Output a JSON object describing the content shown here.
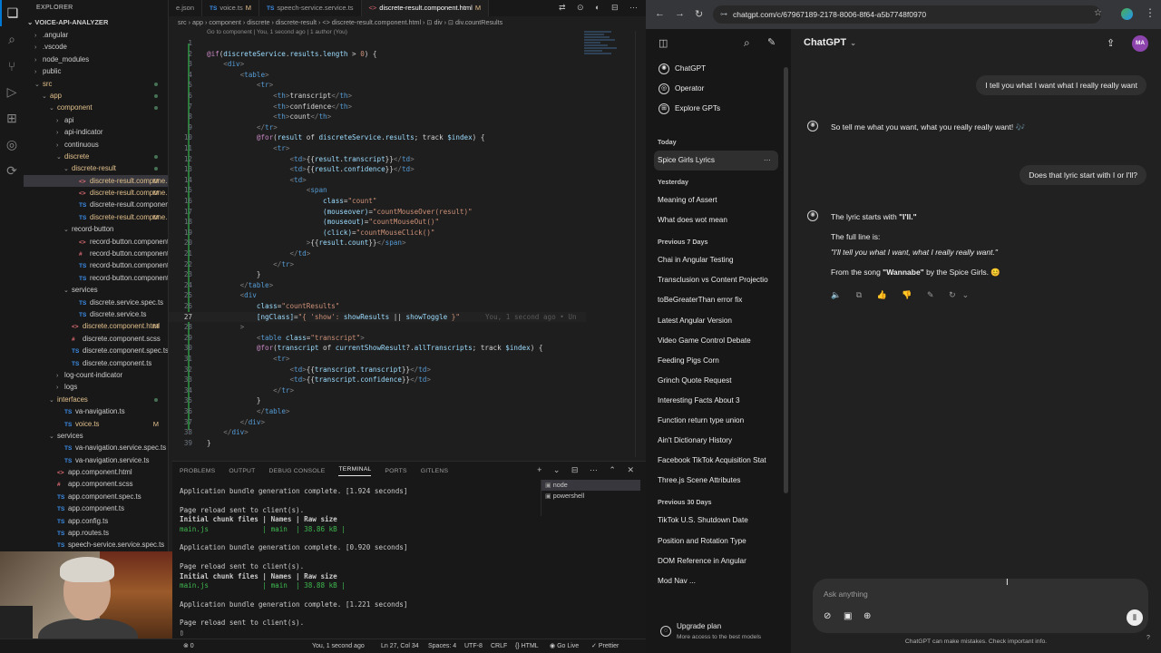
{
  "vscode": {
    "explorer_title": "EXPLORER",
    "project_name": "VOICE-API-ANALYZER",
    "tree": [
      {
        "label": ".angular",
        "indent": 1,
        "chev": "›",
        "icon": "",
        "icon_cls": ""
      },
      {
        "label": ".vscode",
        "indent": 1,
        "chev": "›",
        "icon": "",
        "icon_cls": ""
      },
      {
        "label": "node_modules",
        "indent": 1,
        "chev": "›",
        "icon": "",
        "icon_cls": ""
      },
      {
        "label": "public",
        "indent": 1,
        "chev": "›",
        "icon": "",
        "icon_cls": ""
      },
      {
        "label": "src",
        "indent": 1,
        "chev": "⌄",
        "icon": "",
        "icon_cls": "",
        "cls": "c-orange",
        "dot": true
      },
      {
        "label": "app",
        "indent": 2,
        "chev": "⌄",
        "icon": "",
        "icon_cls": "",
        "cls": "c-orange",
        "dot": true
      },
      {
        "label": "component",
        "indent": 3,
        "chev": "⌄",
        "icon": "",
        "icon_cls": "",
        "cls": "c-orange",
        "dot": true
      },
      {
        "label": "api",
        "indent": 4,
        "chev": "›",
        "icon": "",
        "icon_cls": ""
      },
      {
        "label": "api-indicator",
        "indent": 4,
        "chev": "›",
        "icon": "",
        "icon_cls": ""
      },
      {
        "label": "continuous",
        "indent": 4,
        "chev": "›",
        "icon": "",
        "icon_cls": ""
      },
      {
        "label": "discrete",
        "indent": 4,
        "chev": "⌄",
        "icon": "",
        "icon_cls": "",
        "cls": "c-orange",
        "dot": true
      },
      {
        "label": "discrete-result",
        "indent": 5,
        "chev": "⌄",
        "icon": "",
        "icon_cls": "",
        "cls": "c-orange",
        "dot": true
      },
      {
        "label": "discrete-result.compone...",
        "indent": 6,
        "chev": "",
        "icon": "<>",
        "icon_cls": "c-ng",
        "cls": "c-orange",
        "badge": "M",
        "sel": true
      },
      {
        "label": "discrete-result.compone...",
        "indent": 6,
        "chev": "",
        "icon": "<>",
        "icon_cls": "c-ng",
        "cls": "c-orange",
        "badge": "M"
      },
      {
        "label": "discrete-result.component.spe...",
        "indent": 6,
        "chev": "",
        "icon": "TS",
        "icon_cls": "c-ts"
      },
      {
        "label": "discrete-result.compone...",
        "indent": 6,
        "chev": "",
        "icon": "TS",
        "icon_cls": "c-ts",
        "cls": "c-orange",
        "badge": "M"
      },
      {
        "label": "record-button",
        "indent": 5,
        "chev": "⌄",
        "icon": "",
        "icon_cls": ""
      },
      {
        "label": "record-button.component.html",
        "indent": 6,
        "chev": "",
        "icon": "<>",
        "icon_cls": "c-ng"
      },
      {
        "label": "record-button.component.scss",
        "indent": 6,
        "chev": "",
        "icon": "#",
        "icon_cls": "c-ng"
      },
      {
        "label": "record-button.component.spe...",
        "indent": 6,
        "chev": "",
        "icon": "TS",
        "icon_cls": "c-ts"
      },
      {
        "label": "record-button.component.ts",
        "indent": 6,
        "chev": "",
        "icon": "TS",
        "icon_cls": "c-ts"
      },
      {
        "label": "services",
        "indent": 5,
        "chev": "⌄",
        "icon": "",
        "icon_cls": ""
      },
      {
        "label": "discrete.service.spec.ts",
        "indent": 6,
        "chev": "",
        "icon": "TS",
        "icon_cls": "c-ts"
      },
      {
        "label": "discrete.service.ts",
        "indent": 6,
        "chev": "",
        "icon": "TS",
        "icon_cls": "c-ts"
      },
      {
        "label": "discrete.component.html",
        "indent": 5,
        "chev": "",
        "icon": "<>",
        "icon_cls": "c-ng",
        "cls": "c-orange",
        "badge": "M"
      },
      {
        "label": "discrete.component.scss",
        "indent": 5,
        "chev": "",
        "icon": "#",
        "icon_cls": "c-ng"
      },
      {
        "label": "discrete.component.spec.ts",
        "indent": 5,
        "chev": "",
        "icon": "TS",
        "icon_cls": "c-ts"
      },
      {
        "label": "discrete.component.ts",
        "indent": 5,
        "chev": "",
        "icon": "TS",
        "icon_cls": "c-ts"
      },
      {
        "label": "log-count-indicator",
        "indent": 4,
        "chev": "›",
        "icon": "",
        "icon_cls": ""
      },
      {
        "label": "logs",
        "indent": 4,
        "chev": "›",
        "icon": "",
        "icon_cls": ""
      },
      {
        "label": "interfaces",
        "indent": 3,
        "chev": "⌄",
        "icon": "",
        "icon_cls": "",
        "cls": "c-orange",
        "dot": true
      },
      {
        "label": "va-navigation.ts",
        "indent": 4,
        "chev": "",
        "icon": "TS",
        "icon_cls": "c-ts"
      },
      {
        "label": "voice.ts",
        "indent": 4,
        "chev": "",
        "icon": "TS",
        "icon_cls": "c-ts",
        "cls": "c-orange",
        "badge": "M"
      },
      {
        "label": "services",
        "indent": 3,
        "chev": "⌄",
        "icon": "",
        "icon_cls": ""
      },
      {
        "label": "va-navigation.service.spec.ts",
        "indent": 4,
        "chev": "",
        "icon": "TS",
        "icon_cls": "c-ts"
      },
      {
        "label": "va-navigation.service.ts",
        "indent": 4,
        "chev": "",
        "icon": "TS",
        "icon_cls": "c-ts"
      },
      {
        "label": "app.component.html",
        "indent": 3,
        "chev": "",
        "icon": "<>",
        "icon_cls": "c-ng"
      },
      {
        "label": "app.component.scss",
        "indent": 3,
        "chev": "",
        "icon": "#",
        "icon_cls": "c-ng"
      },
      {
        "label": "app.component.spec.ts",
        "indent": 3,
        "chev": "",
        "icon": "TS",
        "icon_cls": "c-ts"
      },
      {
        "label": "app.component.ts",
        "indent": 3,
        "chev": "",
        "icon": "TS",
        "icon_cls": "c-ts"
      },
      {
        "label": "app.config.ts",
        "indent": 3,
        "chev": "",
        "icon": "TS",
        "icon_cls": "c-ts"
      },
      {
        "label": "app.routes.ts",
        "indent": 3,
        "chev": "",
        "icon": "TS",
        "icon_cls": "c-ts"
      },
      {
        "label": "speech-service.service.spec.ts",
        "indent": 3,
        "chev": "",
        "icon": "TS",
        "icon_cls": "c-ts"
      }
    ],
    "tabs": [
      {
        "label": "e.json",
        "prefix": "",
        "prefix_cls": "",
        "mod": ""
      },
      {
        "label": "voice.ts",
        "prefix": "TS",
        "prefix_cls": "ts",
        "mod": "M"
      },
      {
        "label": "speech-service.service.ts",
        "prefix": "TS",
        "prefix_cls": "ts",
        "mod": ""
      },
      {
        "label": "discrete-result.component.html",
        "prefix": "<>",
        "prefix_cls": "ng",
        "mod": "M",
        "active": true
      }
    ],
    "breadcrumb": "src › app › component › discrete › discrete-result › <> discrete-result.component.html › ⊡ div › ⊡ div.countResults",
    "codelens": "Go to component | You, 1 second ago | 1 author (You)",
    "code_lines": [
      {
        "n": "1",
        "html": ""
      },
      {
        "n": "2",
        "html": "<span class='tk-k'>@if</span>(<span class='tk-var'>discreteService</span>.<span class='tk-var'>results</span>.<span class='tk-var'>length</span> &gt; <span class='tk-str'>0</span>) {"
      },
      {
        "n": "3",
        "html": "    <span class='tk-gray'>&lt;</span><span class='tk-tag'>div</span><span class='tk-gray'>&gt;</span>"
      },
      {
        "n": "4",
        "html": "        <span class='tk-gray'>&lt;</span><span class='tk-tag'>table</span><span class='tk-gray'>&gt;</span>"
      },
      {
        "n": "5",
        "html": "            <span class='tk-gray'>&lt;</span><span class='tk-tag'>tr</span><span class='tk-gray'>&gt;</span>"
      },
      {
        "n": "6",
        "html": "                <span class='tk-gray'>&lt;</span><span class='tk-tag'>th</span><span class='tk-gray'>&gt;</span>transcript<span class='tk-gray'>&lt;/</span><span class='tk-tag'>th</span><span class='tk-gray'>&gt;</span>"
      },
      {
        "n": "7",
        "html": "                <span class='tk-gray'>&lt;</span><span class='tk-tag'>th</span><span class='tk-gray'>&gt;</span>confidence<span class='tk-gray'>&lt;/</span><span class='tk-tag'>th</span><span class='tk-gray'>&gt;</span>"
      },
      {
        "n": "8",
        "html": "                <span class='tk-gray'>&lt;</span><span class='tk-tag'>th</span><span class='tk-gray'>&gt;</span>count<span class='tk-gray'>&lt;/</span><span class='tk-tag'>th</span><span class='tk-gray'>&gt;</span>"
      },
      {
        "n": "9",
        "html": "            <span class='tk-gray'>&lt;/</span><span class='tk-tag'>tr</span><span class='tk-gray'>&gt;</span>"
      },
      {
        "n": "10",
        "html": "            <span class='tk-k'>@for</span>(<span class='tk-var'>result</span> of <span class='tk-var'>discreteService</span>.<span class='tk-var'>results</span>; track <span class='tk-var'>$index</span>) {"
      },
      {
        "n": "11",
        "html": "                <span class='tk-gray'>&lt;</span><span class='tk-tag'>tr</span><span class='tk-gray'>&gt;</span>"
      },
      {
        "n": "12",
        "html": "                    <span class='tk-gray'>&lt;</span><span class='tk-tag'>td</span><span class='tk-gray'>&gt;</span>{{<span class='tk-var'>result</span>.<span class='tk-var'>transcript</span>}}<span class='tk-gray'>&lt;/</span><span class='tk-tag'>td</span><span class='tk-gray'>&gt;</span>"
      },
      {
        "n": "13",
        "html": "                    <span class='tk-gray'>&lt;</span><span class='tk-tag'>td</span><span class='tk-gray'>&gt;</span>{{<span class='tk-var'>result</span>.<span class='tk-var'>confidence</span>}}<span class='tk-gray'>&lt;/</span><span class='tk-tag'>td</span><span class='tk-gray'>&gt;</span>"
      },
      {
        "n": "14",
        "html": "                    <span class='tk-gray'>&lt;</span><span class='tk-tag'>td</span><span class='tk-gray'>&gt;</span>"
      },
      {
        "n": "15",
        "html": "                        <span class='tk-gray'>&lt;</span><span class='tk-tag'>span</span>"
      },
      {
        "n": "16",
        "html": "                            <span class='tk-attr'>class</span>=<span class='tk-str'>\"count\"</span>"
      },
      {
        "n": "17",
        "html": "                            <span class='tk-attr'>(mouseover)</span>=<span class='tk-str'>\"countMouseOver(result)\"</span>"
      },
      {
        "n": "18",
        "html": "                            <span class='tk-attr'>(mouseout)</span>=<span class='tk-str'>\"countMouseOut()\"</span>"
      },
      {
        "n": "19",
        "html": "                            <span class='tk-attr'>(click)</span>=<span class='tk-str'>\"countMouseClick()\"</span>"
      },
      {
        "n": "20",
        "html": "                        <span class='tk-gray'>&gt;</span>{{<span class='tk-var'>result</span>.<span class='tk-var'>count</span>}}<span class='tk-gray'>&lt;/</span><span class='tk-tag'>span</span><span class='tk-gray'>&gt;</span>"
      },
      {
        "n": "21",
        "html": "                    <span class='tk-gray'>&lt;/</span><span class='tk-tag'>td</span><span class='tk-gray'>&gt;</span>"
      },
      {
        "n": "22",
        "html": "                <span class='tk-gray'>&lt;/</span><span class='tk-tag'>tr</span><span class='tk-gray'>&gt;</span>"
      },
      {
        "n": "23",
        "html": "            }"
      },
      {
        "n": "24",
        "html": "        <span class='tk-gray'>&lt;/</span><span class='tk-tag'>table</span><span class='tk-gray'>&gt;</span>"
      },
      {
        "n": "25",
        "html": "        <span class='tk-gray'>&lt;</span><span class='tk-tag'>div</span>"
      },
      {
        "n": "26",
        "html": "            <span class='tk-attr'>class</span>=<span class='tk-str'>\"countResults\"</span>"
      },
      {
        "n": "27",
        "html": "            <span class='tk-attr'>[ngClass]</span>=<span class='tk-str'>\"{ 'show': </span><span class='tk-var'>showResults</span> || <span class='tk-var'>showToggle</span><span class='tk-str'> }\"</span><span class='blame'>You, 1 second ago • Un</span>",
        "cur": true
      },
      {
        "n": "28",
        "html": "        <span class='tk-gray'>&gt;</span>"
      },
      {
        "n": "29",
        "html": "            <span class='tk-gray'>&lt;</span><span class='tk-tag'>table</span> <span class='tk-attr'>class</span>=<span class='tk-str'>\"transcript\"</span><span class='tk-gray'>&gt;</span>"
      },
      {
        "n": "30",
        "html": "            <span class='tk-k'>@for</span>(<span class='tk-var'>transcript</span> of <span class='tk-var'>currentShowResult</span>?.<span class='tk-var'>allTranscripts</span>; track <span class='tk-var'>$index</span>) {"
      },
      {
        "n": "31",
        "html": "                <span class='tk-gray'>&lt;</span><span class='tk-tag'>tr</span><span class='tk-gray'>&gt;</span>"
      },
      {
        "n": "32",
        "html": "                    <span class='tk-gray'>&lt;</span><span class='tk-tag'>td</span><span class='tk-gray'>&gt;</span>{{<span class='tk-var'>transcript</span>.<span class='tk-var'>transcript</span>}}<span class='tk-gray'>&lt;/</span><span class='tk-tag'>td</span><span class='tk-gray'>&gt;</span>"
      },
      {
        "n": "33",
        "html": "                    <span class='tk-gray'>&lt;</span><span class='tk-tag'>td</span><span class='tk-gray'>&gt;</span>{{<span class='tk-var'>transcript</span>.<span class='tk-var'>confidence</span>}}<span class='tk-gray'>&lt;/</span><span class='tk-tag'>td</span><span class='tk-gray'>&gt;</span>"
      },
      {
        "n": "34",
        "html": "                <span class='tk-gray'>&lt;/</span><span class='tk-tag'>tr</span><span class='tk-gray'>&gt;</span>"
      },
      {
        "n": "35",
        "html": "            }"
      },
      {
        "n": "36",
        "html": "            <span class='tk-gray'>&lt;/</span><span class='tk-tag'>table</span><span class='tk-gray'>&gt;</span>"
      },
      {
        "n": "37",
        "html": "        <span class='tk-gray'>&lt;/</span><span class='tk-tag'>div</span><span class='tk-gray'>&gt;</span>"
      },
      {
        "n": "38",
        "html": "    <span class='tk-gray'>&lt;/</span><span class='tk-tag'>div</span><span class='tk-gray'>&gt;</span>"
      },
      {
        "n": "39",
        "html": "}"
      }
    ],
    "panel_tabs": [
      "PROBLEMS",
      "OUTPUT",
      "DEBUG CONSOLE",
      "TERMINAL",
      "PORTS",
      "GITLENS"
    ],
    "panel_active": "TERMINAL",
    "panel_actions": "+ ⌄ ⊟ ⋯ ⌃ ✕",
    "terminal_lines": [
      {
        "t": "Application bundle generation complete. [1.924 seconds]",
        "c": ""
      },
      {
        "t": "",
        "c": ""
      },
      {
        "t": "Page reload sent to client(s).",
        "c": ""
      },
      {
        "t": "Initial chunk files | Names | Raw size",
        "c": "b"
      },
      {
        "t": "main.js             | main  | 38.86 kB |",
        "c": "g"
      },
      {
        "t": "",
        "c": ""
      },
      {
        "t": "Application bundle generation complete. [0.920 seconds]",
        "c": ""
      },
      {
        "t": "",
        "c": ""
      },
      {
        "t": "Page reload sent to client(s).",
        "c": ""
      },
      {
        "t": "Initial chunk files | Names | Raw size",
        "c": "b"
      },
      {
        "t": "main.js             | main  | 38.88 kB |",
        "c": "g"
      },
      {
        "t": "",
        "c": ""
      },
      {
        "t": "Application bundle generation complete. [1.221 seconds]",
        "c": ""
      },
      {
        "t": "",
        "c": ""
      },
      {
        "t": "Page reload sent to client(s).",
        "c": ""
      },
      {
        "t": "▯",
        "c": ""
      }
    ],
    "terminals": [
      "node",
      "powershell"
    ],
    "status": {
      "errors": "⊗ 0",
      "blame": "You, 1 second ago",
      "position": "Ln 27, Col 34",
      "spaces": "Spaces: 4",
      "encoding": "UTF-8",
      "eol": "CRLF",
      "language": "{} HTML",
      "golive": "Go Live",
      "prettier": "Prettier"
    }
  },
  "browser": {
    "url": "chatgpt.com/c/67967189-2178-8006-8f64-a5b7748f0970",
    "top_items": [
      "ChatGPT",
      "Operator",
      "Explore GPTs"
    ],
    "sections": [
      {
        "head": "Today",
        "items": [
          "Spice Girls Lyrics"
        ]
      },
      {
        "head": "Yesterday",
        "items": [
          "Meaning of Assert",
          "What does wot mean"
        ]
      },
      {
        "head": "Previous 7 Days",
        "items": [
          "Chai in Angular Testing",
          "Transclusion vs Content Projectio",
          "toBeGreaterThan error fix",
          "Latest Angular Version",
          "Video Game Control Debate",
          "Feeding Pigs Corn",
          "Grinch Quote Request",
          "Interesting Facts About 3",
          "Function return type union",
          "Ain't Dictionary History",
          "Facebook TikTok Acquisition Stat",
          "Three.js Scene Attributes"
        ]
      },
      {
        "head": "Previous 30 Days",
        "items": [
          "TikTok U.S. Shutdown Date",
          "Position and Rotation Type",
          "DOM Reference in Angular",
          "Mod Nav ..."
        ]
      }
    ],
    "upgrade_title": "Upgrade plan",
    "upgrade_sub": "More access to the best models",
    "title": "ChatGPT",
    "avatar": "MA",
    "messages": {
      "user1": "I tell you what I want what I really really want",
      "gpt1": "So tell me what you want, what you really really want! 🎶",
      "user2": "Does that lyric start with I or I'll?",
      "gpt2_a": "The lyric starts with ",
      "gpt2_a_bold": "\"I'll.\"",
      "gpt2_b": "The full line is:",
      "gpt2_c": "\"I'll tell you what I want, what I really really want.\"",
      "gpt2_d": "From the song ",
      "gpt2_d_bold": "\"Wannabe\"",
      "gpt2_d_tail": " by the Spice Girls. 😊"
    },
    "msg_actions": "🔈 ⧉ 👍 👎 ✎ ↻⌄",
    "composer_placeholder": "Ask anything",
    "disclaimer": "ChatGPT can make mistakes. Check important info.",
    "help": "?"
  }
}
